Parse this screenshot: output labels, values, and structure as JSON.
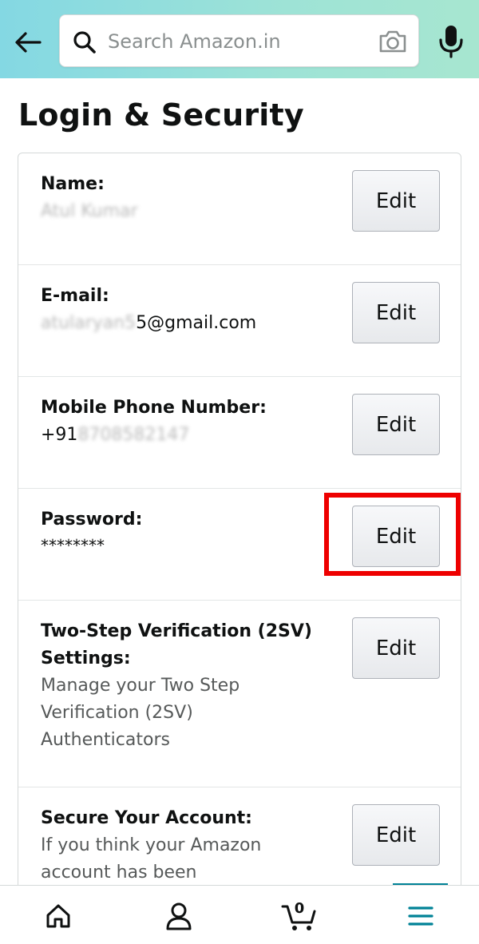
{
  "search": {
    "placeholder": "Search Amazon.in"
  },
  "page": {
    "title": "Login & Security"
  },
  "rows": [
    {
      "label": "Name:",
      "value": "Atul Kumar",
      "button": "Edit"
    },
    {
      "label": "E-mail:",
      "value_prefix": "atularyan5",
      "value": "5@gmail.com",
      "button": "Edit"
    },
    {
      "label": "Mobile Phone Number:",
      "value_prefix": "+91",
      "value_hidden": "8708582147",
      "button": "Edit"
    },
    {
      "label": "Password:",
      "value": "********",
      "button": "Edit"
    },
    {
      "label": "Two-Step Verification (2SV) Settings:",
      "description": "Manage your Two Step Verification (2SV) Authenticators",
      "button": "Edit"
    },
    {
      "label": "Secure Your Account:",
      "description": "If you think your Amazon account has been",
      "button": "Edit"
    }
  ],
  "nav": {
    "cart_count": "0"
  },
  "colors": {
    "accent": "#008296",
    "highlight": "#ee0000",
    "header_start": "#84d8e3",
    "header_end": "#a7e6d0"
  }
}
